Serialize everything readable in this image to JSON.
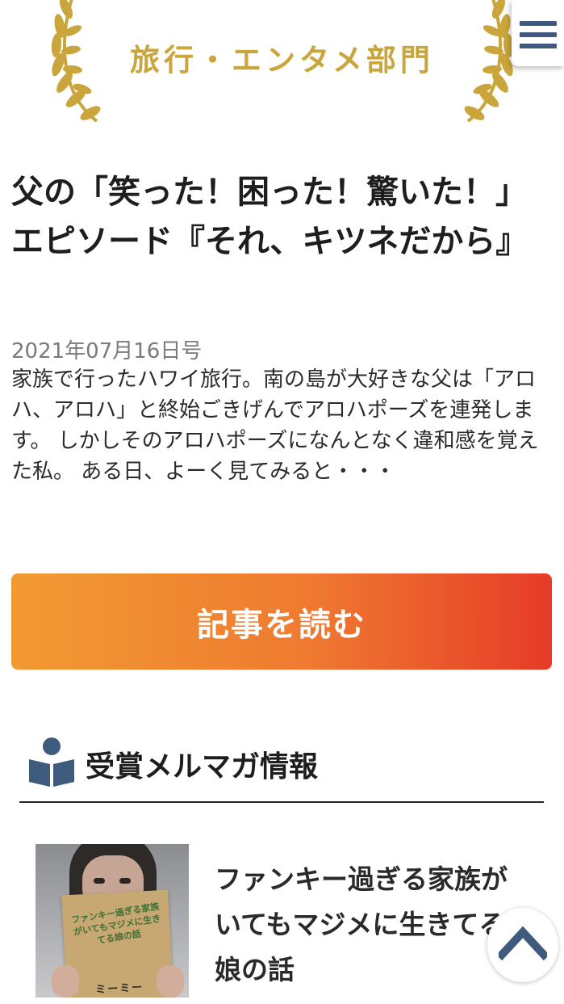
{
  "award": {
    "category_title": "旅行・エンタメ部門"
  },
  "menu": {
    "icon": "hamburger-icon"
  },
  "article": {
    "title": "父の「笑った！困った！驚いた！」エピソード『それ、キツネだから』",
    "date": "2021年07月16日号",
    "excerpt": "家族で行ったハワイ旅行。南の島が大好きな父は「アロハ、アロハ」と終始ごきげんでアロハポーズを連発します。 しかしそのアロハポーズになんとなく違和感を覚えた私。 ある日、よーく見てみると・・・",
    "read_button_label": "記事を読む"
  },
  "section": {
    "icon": "book-reader-icon",
    "heading": "受賞メルマガ情報"
  },
  "newsletter": {
    "title": "ファンキー過ぎる家族がいてもマジメに生きてる娘の話",
    "cover_text": "ファンキー過ぎる家族がいてもマジメに生きてる娘の話",
    "cover_author": "ミーミー"
  },
  "scroll_top": {
    "icon": "chevron-up-icon"
  },
  "colors": {
    "gold": "#c9a53c",
    "navy": "#3e5a7c",
    "button_start": "#f19a33",
    "button_end": "#e63b28"
  }
}
